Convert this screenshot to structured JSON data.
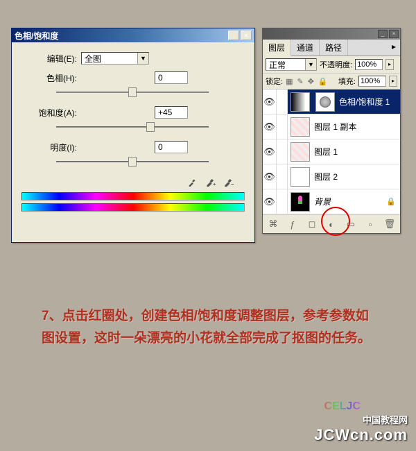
{
  "dialog": {
    "title": "色相/饱和度",
    "edit_label": "编辑(E):",
    "edit_value": "全图",
    "hue_label": "色相(H):",
    "hue_value": "0",
    "sat_label": "饱和度(A):",
    "sat_value": "+45",
    "light_label": "明度(I):",
    "light_value": "0"
  },
  "panel": {
    "tabs": [
      "图层",
      "通道",
      "路径"
    ],
    "blend_value": "正常",
    "opacity_label": "不透明度:",
    "opacity_value": "100%",
    "lock_label": "锁定:",
    "fill_label": "填充:",
    "fill_value": "100%",
    "layers": [
      {
        "name": "色相/饱和度 1"
      },
      {
        "name": "图层 1 副本"
      },
      {
        "name": "图层 1"
      },
      {
        "name": "图层 2"
      },
      {
        "name": "背景"
      }
    ]
  },
  "instruction": {
    "text": "7、点击红圈处，创建色相/饱和度调整图层，参考参数如图设置，这时一朵漂亮的小花就全部完成了抠图的任务。"
  },
  "logo_text": "CELJC",
  "watermark": {
    "line1": "中国教程网",
    "line2": "JCWcn.com"
  }
}
